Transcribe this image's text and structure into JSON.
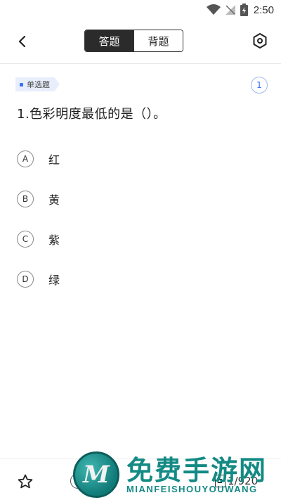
{
  "status_bar": {
    "time": "2:50",
    "icons": [
      "wifi-icon",
      "signal-icon",
      "battery-icon"
    ]
  },
  "header": {
    "tabs": [
      {
        "label": "答题",
        "active": true
      },
      {
        "label": "背题",
        "active": false
      }
    ]
  },
  "question": {
    "type_label": "单选题",
    "number_badge": "1",
    "text": "1.色彩明度最低的是（）。",
    "options": [
      {
        "letter": "A",
        "text": "红"
      },
      {
        "letter": "B",
        "text": "黄"
      },
      {
        "letter": "C",
        "text": "紫"
      },
      {
        "letter": "D",
        "text": "绿"
      }
    ]
  },
  "bottom_bar": {
    "progress": "1/920"
  },
  "watermark": {
    "cn": "免费手游网",
    "en": "MIANFEISHOUYOUWANG",
    "logo_letter": "M"
  },
  "colors": {
    "accent": "#3b6ff5",
    "tag_bg": "#e8eefb",
    "active_tab": "#2b2b2b",
    "watermark": "#138a84"
  }
}
